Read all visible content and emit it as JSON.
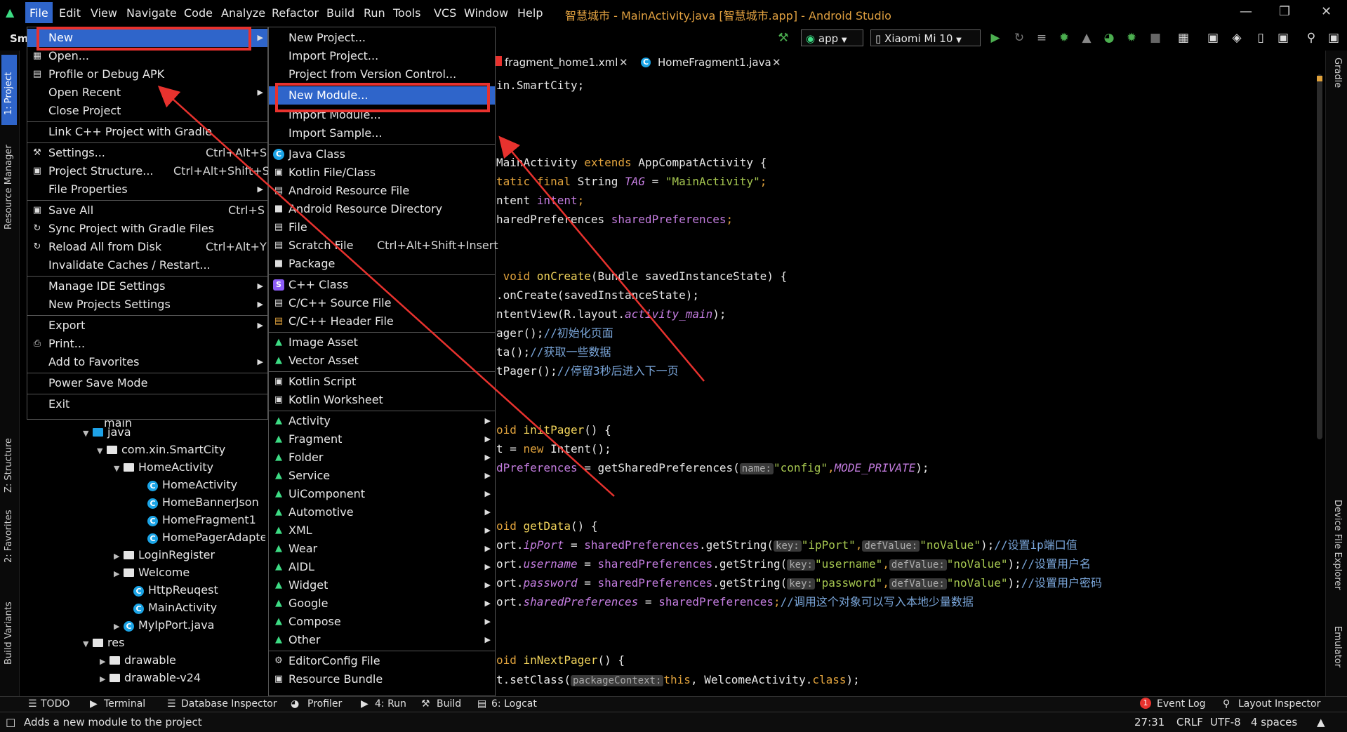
{
  "menubar": {
    "items": [
      "File",
      "Edit",
      "View",
      "Navigate",
      "Code",
      "Analyze",
      "Refactor",
      "Build",
      "Run",
      "Tools",
      "VCS",
      "Window",
      "Help"
    ],
    "window_title": "智慧城市 - MainActivity.java [智慧城市.app] - Android Studio"
  },
  "toolbar": {
    "project_partial": "Sm",
    "config": "app",
    "device": "Xiaomi Mi 10"
  },
  "tabs": [
    "fragment_home1.xml",
    "HomeFragment1.java"
  ],
  "file_menu": {
    "new": "New",
    "open": "Open...",
    "profile": "Profile or Debug APK",
    "open_recent": "Open Recent",
    "close_project": "Close Project",
    "link_cpp": "Link C++ Project with Gradle",
    "settings": "Settings...",
    "settings_sc": "Ctrl+Alt+S",
    "project_structure": "Project Structure...",
    "project_structure_sc": "Ctrl+Alt+Shift+S",
    "file_properties": "File Properties",
    "save_all": "Save All",
    "save_all_sc": "Ctrl+S",
    "sync": "Sync Project with Gradle Files",
    "reload": "Reload All from Disk",
    "reload_sc": "Ctrl+Alt+Y",
    "invalidate": "Invalidate Caches / Restart...",
    "manage_ide": "Manage IDE Settings",
    "new_projects": "New Projects Settings",
    "export": "Export",
    "print": "Print...",
    "favorites": "Add to Favorites",
    "power_save": "Power Save Mode",
    "exit": "Exit"
  },
  "new_menu": {
    "new_project": "New Project...",
    "import_project": "Import Project...",
    "from_vcs": "Project from Version Control...",
    "new_module": "New Module...",
    "import_module": "Import Module...",
    "import_sample": "Import Sample...",
    "java_class": "Java Class",
    "kotlin_file": "Kotlin File/Class",
    "android_resource_file": "Android Resource File",
    "android_resource_dir": "Android Resource Directory",
    "file": "File",
    "scratch": "Scratch File",
    "scratch_sc": "Ctrl+Alt+Shift+Insert",
    "package": "Package",
    "cpp_class": "C++ Class",
    "cpp_source": "C/C++ Source File",
    "cpp_header": "C/C++ Header File",
    "image_asset": "Image Asset",
    "vector_asset": "Vector Asset",
    "kotlin_script": "Kotlin Script",
    "kotlin_worksheet": "Kotlin Worksheet",
    "activity": "Activity",
    "fragment": "Fragment",
    "folder": "Folder",
    "service": "Service",
    "ui_component": "UiComponent",
    "automotive": "Automotive",
    "xml": "XML",
    "wear": "Wear",
    "aidl": "AIDL",
    "widget": "Widget",
    "google": "Google",
    "compose": "Compose",
    "other": "Other",
    "editorconfig": "EditorConfig File",
    "resource_bundle": "Resource Bundle"
  },
  "tree": {
    "main": "main",
    "java": "java",
    "pkg": "com.xin.SmartCity",
    "home_activity_pkg": "HomeActivity",
    "home_activity": "HomeActivity",
    "banner": "HomeBannerJson",
    "fragment1": "HomeFragment1",
    "pager_adapter": "HomePagerAdapter",
    "login": "LoginRegister",
    "welcome": "Welcome",
    "http": "HttpReuqest",
    "main_activity": "MainActivity",
    "myip": "MyIpPort.java",
    "res": "res",
    "drawable": "drawable",
    "drawable_v24": "drawable-v24"
  },
  "side_tabs": {
    "project": "1: Project",
    "resource_manager": "Resource Manager",
    "structure": "Z: Structure",
    "favorites": "2: Favorites",
    "build_variants": "Build Variants",
    "gradle": "Gradle",
    "device_file": "Device File Explorer",
    "emulator": "Emulator"
  },
  "code": {
    "l1a": "in.SmartCity;",
    "l2a": "MainActivity ",
    "l2b": "extends",
    "l2c": " AppCompatActivity {",
    "l3a": "tatic final",
    "l3b": " String ",
    "l3c": "TAG",
    "l3d": " = ",
    "l3e": "\"MainActivity\"",
    "l3f": ";",
    "l4a": "ntent ",
    "l4b": "intent",
    "l4c": ";",
    "l5a": "haredPreferences ",
    "l5b": "sharedPreferences",
    "l5c": ";",
    "l6a": " void ",
    "l6b": "onCreate",
    "l6c": "(Bundle savedInstanceState) {",
    "l7a": ".onCreate(savedInstanceState);",
    "l8a": "ntentView(R.layout.",
    "l8b": "activity_main",
    "l8c": ");",
    "l9a": "ager();",
    "l9b": "//初始化页面",
    "l10a": "ta();",
    "l10b": "//获取一些数据",
    "l11a": "tPager();",
    "l11b": "//停留3秒后进入下一页",
    "l12a": "oid ",
    "l12b": "initPager",
    "l12c": "() {",
    "l13a": "t = ",
    "l13b": "new",
    "l13c": " Intent();",
    "l14a": "dPreferences",
    "l14b": " = getSharedPreferences(",
    "l14h": "name:",
    "l14c": "\"config\"",
    "l14d": ",",
    "l14e": "MODE_PRIVATE",
    "l14f": ");",
    "l15a": "oid ",
    "l15b": "getData",
    "l15c": "() {",
    "l16a": "ort.",
    "l16b": "ipPort",
    "l16c": " = ",
    "l16d": "sharedPreferences",
    "l16e": ".getString(",
    "l16h1": "key:",
    "l16f": "\"ipPort\"",
    "l16g": ",",
    "l16h2": "defValue:",
    "l16i": "\"noValue\"",
    "l16j": ");",
    "l16k": "//设置ip端口值",
    "l17a": "ort.",
    "l17b": "username",
    "l17f": "\"username\"",
    "l17k": "//设置用户名",
    "l18a": "ort.",
    "l18b": "password",
    "l18f": "\"password\"",
    "l18k": "//设置用户密码",
    "l19a": "ort.",
    "l19b": "sharedPreferences",
    "l19c": " = ",
    "l19d": "sharedPreferences",
    "l19e": ";",
    "l19k": "//调用这个对象可以写入本地少量数据",
    "l20a": "oid ",
    "l20b": "inNextPager",
    "l20c": "() {",
    "l21a": "t.setClass(",
    "l21h": "packageContext:",
    "l21b": "this",
    "l21c": ", WelcomeActivity.",
    "l21d": "class",
    "l21e": ");"
  },
  "bottom_tabs": {
    "todo": "TODO",
    "terminal": "Terminal",
    "db": "Database Inspector",
    "profiler": "Profiler",
    "run": "4: Run",
    "build": "Build",
    "logcat": "6: Logcat",
    "event_log_count": "1",
    "event_log": "Event Log",
    "layout_inspector": "Layout Inspector"
  },
  "status": {
    "message": "Adds a new module to the project",
    "position": "27:31",
    "line_sep": "CRLF",
    "encoding": "UTF-8",
    "indent": "4 spaces"
  },
  "colors": {
    "selection": "#2f65ca",
    "annotation_red": "#e8322e",
    "keyword": "#e0a23c",
    "string": "#a6c750"
  }
}
